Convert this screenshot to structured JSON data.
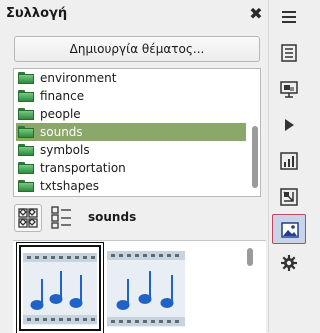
{
  "panel": {
    "title": "Συλλογή",
    "new_theme_button": "Δημιουργία θέματος...",
    "themes": [
      {
        "label": "environment",
        "selected": false
      },
      {
        "label": "finance",
        "selected": false
      },
      {
        "label": "people",
        "selected": false
      },
      {
        "label": "sounds",
        "selected": true
      },
      {
        "label": "symbols",
        "selected": false
      },
      {
        "label": "transportation",
        "selected": false
      },
      {
        "label": "txtshapes",
        "selected": false
      }
    ],
    "current_theme": "sounds",
    "view_buttons": [
      "icon-view",
      "detail-view"
    ]
  },
  "gallery": {
    "items": [
      {
        "icon": "music-notes-filmstrip",
        "selected": true
      },
      {
        "icon": "music-notes-filmstrip",
        "selected": false
      }
    ]
  },
  "sidebar": {
    "buttons": [
      {
        "icon": "menu-icon",
        "active": false
      },
      {
        "icon": "properties-icon",
        "active": false
      },
      {
        "icon": "slide-transition-icon",
        "active": false
      },
      {
        "icon": "animation-icon",
        "active": false
      },
      {
        "icon": "master-slides-icon",
        "active": false
      },
      {
        "icon": "navigator-icon",
        "active": false
      },
      {
        "icon": "gallery-icon",
        "active": true
      },
      {
        "icon": "settings-icon",
        "active": false
      }
    ]
  },
  "colors": {
    "selection_row": "#8ba86a",
    "active_sidebar_border": "#c4455f",
    "active_sidebar_fill": "#c9d4e9",
    "note_blue": "#1f63c9"
  }
}
